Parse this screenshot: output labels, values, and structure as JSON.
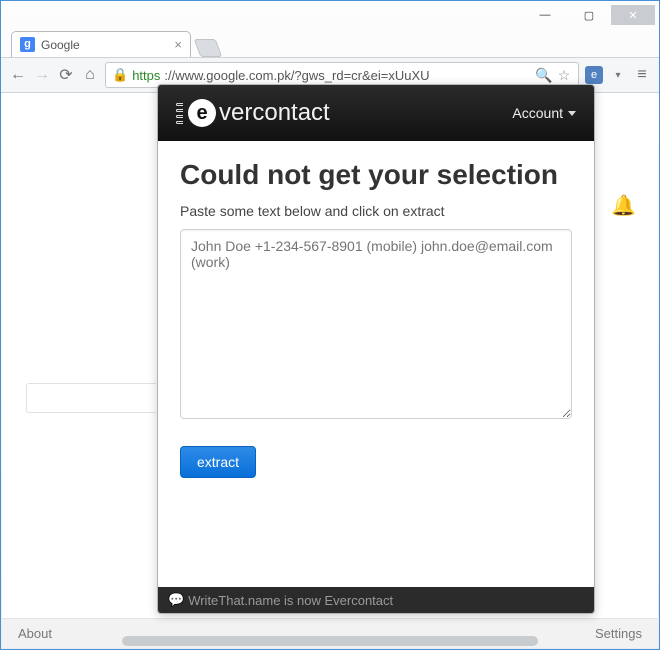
{
  "window": {
    "controls": {
      "min": "—",
      "max": "▢",
      "close": "✕"
    }
  },
  "tab": {
    "title": "Google",
    "favicon_letter": "g"
  },
  "toolbar": {
    "back": "←",
    "forward": "→",
    "reload": "⟳",
    "home": "⌂",
    "menu": "≡",
    "url_scheme": "https",
    "url_rest": "://www.google.com.pk/?gws_rd=cr&ei=xUuXU",
    "lock": "🔒",
    "omni_search": "🔍",
    "omni_star": "☆",
    "ext_badge": "e",
    "ext_caret": "▾"
  },
  "page": {
    "about": "About",
    "settings": "Settings",
    "bell": "🔔"
  },
  "popup": {
    "brand_prefix": "",
    "brand_e": "e",
    "brand_rest": "vercontact",
    "account_label": "Account",
    "heading": "Could not get your selection",
    "subtext": "Paste some text below and click on extract",
    "placeholder": "John Doe +1-234-567-8901 (mobile) john.doe@email.com (work)",
    "textarea_value": "",
    "button_label": "extract",
    "footer_icon": "💬",
    "footer_text": "WriteThat.name is now Evercontact"
  }
}
